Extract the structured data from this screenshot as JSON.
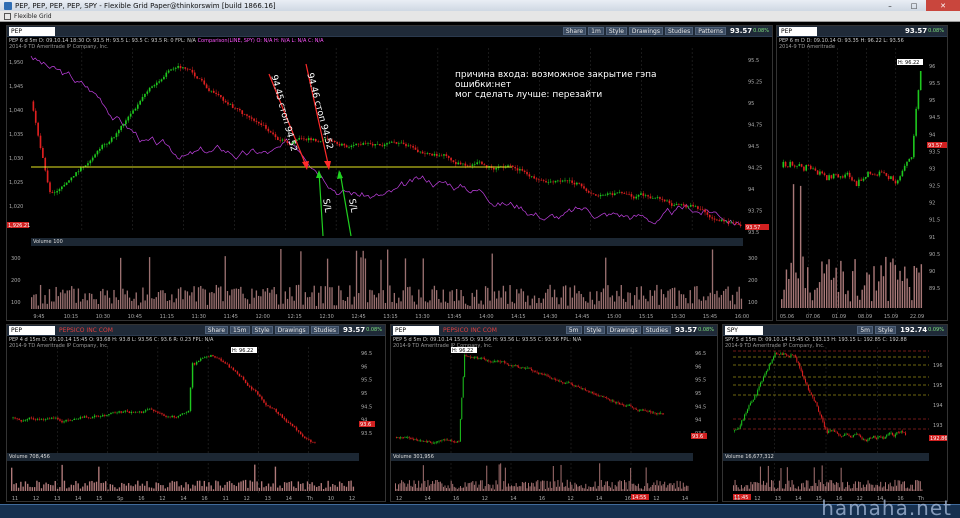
{
  "window": {
    "title": "PEP, PEP, PEP, PEP, SPY - Flexible Grid Paper@thinkorswim [build 1866.16]",
    "menu_label": "Flexible Grid",
    "min": "–",
    "max": "□",
    "close": "✕"
  },
  "toolbar_labels": {
    "share": "Share",
    "style": "Style",
    "drawings": "Drawings",
    "studies": "Studies",
    "patterns": "Patterns"
  },
  "panels": {
    "main": {
      "symbol": "PEP",
      "company": "PEPSICO INC COM",
      "last": "93.57",
      "chg": "0.08%",
      "tf": "1m",
      "info": "PEP 6 d 5m  D: 09.10.14 18:30  O: 93.5  H: 93.5  L: 93.5  C: 93.5  R: 0  FPL: N/A",
      "comparison": "Comparison(LINE, SPY)  O: N/A  H: N/A  L: N/A  C: N/A",
      "sub": "2014-9 TD Ameritrade IP Company, Inc.",
      "left_badge": "1,926.21",
      "right_badge": "93.57",
      "y_right": [
        "95.5",
        "95.25",
        "95",
        "94.75",
        "94.5",
        "94.25",
        "94",
        "93.75",
        "93.5"
      ],
      "y_left": [
        "1,950",
        "1,945",
        "1,040",
        "1,035",
        "1,030",
        "1,025",
        "1,020"
      ],
      "x": [
        "9:45",
        "10:15",
        "10:30",
        "10:45",
        "11:15",
        "11:30",
        "11:45",
        "12:00",
        "12:15",
        "12:30",
        "12:45",
        "13:15",
        "13:30",
        "13:45",
        "14:00",
        "14:15",
        "14:30",
        "14:45",
        "15:00",
        "15:15",
        "15:30",
        "15:45",
        "16:00"
      ],
      "volume_label": "Volume",
      "volume_value": "100",
      "vol_y": [
        "300",
        "200",
        "100"
      ]
    },
    "right": {
      "symbol": "PEP",
      "last": "93.57",
      "chg": "0.08%",
      "info": "PEP 6 m D  D: 09.10.14  O: 93.35  H: 96.22  L: 93.56",
      "sub": "2014-9 TD Ameritrade",
      "high_label": "H: 96.22",
      "price_badge": "93.57",
      "y": [
        "96",
        "95.5",
        "95",
        "94.5",
        "94",
        "93.5",
        "93",
        "92.5",
        "92",
        "91.5",
        "91",
        "90.5",
        "90",
        "89.5"
      ],
      "x": [
        "05.06",
        "07.06",
        "01.09",
        "08.09",
        "15.09",
        "22.09"
      ]
    },
    "bl": {
      "symbol": "PEP",
      "company": "PEPSICO INC COM",
      "last": "93.57",
      "chg": "0.08%",
      "tf": "15m",
      "info": "PEP 4 d 15m  D: 09.10.14 15:45  O: 93.68  H: 93.8  L: 93.56  C: 93.6  R: 0.23  FPL: N/A",
      "sub": "2014-9 TD Ameritrade IP Company, Inc.",
      "high_label": "H: 96.22",
      "price_badge": "93.6",
      "y": [
        "96.5",
        "96",
        "95.5",
        "95",
        "94.5",
        "94",
        "93.5"
      ],
      "x": [
        "11",
        "12",
        "13",
        "14",
        "15",
        "Sp",
        "16",
        "12",
        "14",
        "16",
        "11",
        "12",
        "13",
        "14",
        "Th",
        "10",
        "12"
      ],
      "volume_label": "Volume",
      "volume_value": "708,456"
    },
    "bm": {
      "symbol": "PEP",
      "company": "PEPSICO INC COM",
      "last": "93.57",
      "chg": "0.08%",
      "tf": "5m",
      "info": "PEP 5 d 5m  D: 09.10.14 15:55  O: 93.56  H: 93.56  L: 93.55  C: 93.56  FPL: N/A",
      "sub": "2014-9 TD Ameritrade IP Company, Inc.",
      "high_label": "H: 96.22",
      "price_badge": "93.6",
      "y": [
        "96.5",
        "96",
        "95.5",
        "95",
        "94.5",
        "94",
        "93.5"
      ],
      "x": [
        "12",
        "14",
        "16",
        "12",
        "14",
        "16",
        "12",
        "14",
        "16",
        "12",
        "14"
      ],
      "time_badge": "14:55",
      "volume_label": "Volume",
      "volume_value": "301,956"
    },
    "br": {
      "symbol": "SPY",
      "last": "192.74",
      "chg": "0.09%",
      "tf": "5m",
      "info": "SPY 5 d 15m  D: 09.10.14 15:45  O: 193.13  H: 193.15  L: 192.85  C: 192.88",
      "sub": "2014-9 TD Ameritrade IP Company, Inc.",
      "price_badge": "192.86",
      "y": [
        "196",
        "195",
        "194",
        "193"
      ],
      "x": [
        "11",
        "12",
        "13",
        "14",
        "15",
        "16",
        "12",
        "14",
        "16",
        "Th"
      ],
      "time_badge": "11:45",
      "volume_label": "Volume",
      "volume_value": "16,677,312"
    }
  },
  "annotations": {
    "lines": [
      "причина входа: возможное закрытие гэпа",
      "ошибки:нет",
      "мог сделать лучше: перезайти"
    ],
    "stop1": "94.45 стоп 94.52",
    "stop2": "94.46 стоп 94.52",
    "sl1": "S/L",
    "sl2": "S/L"
  },
  "watermark": "hamaha.net",
  "colors": {
    "up": "#1ec81e",
    "down": "#e02020",
    "comparison": "#c040e0",
    "level": "#e6e620",
    "bg": "#000000",
    "arrow_down": "#ff2a2a",
    "arrow_up": "#20d020"
  }
}
